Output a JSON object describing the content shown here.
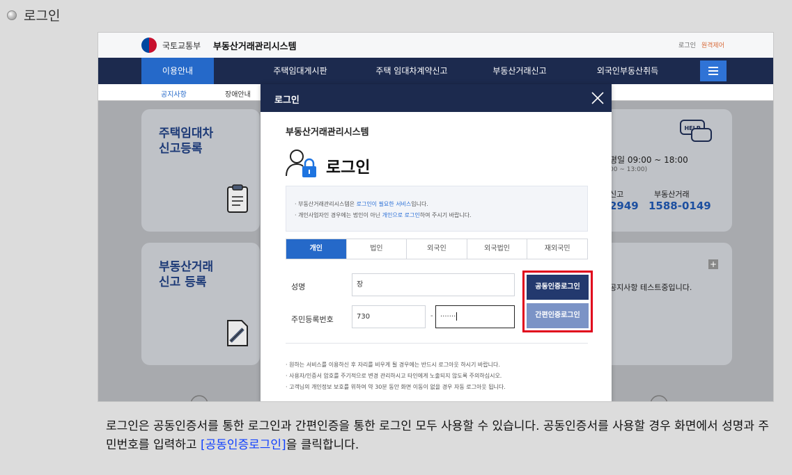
{
  "page": {
    "heading": "로그인",
    "caption_pre": "로그인은 공동인증서를 통한 로그인과 간편인증을 통한 로그인 모두 사용할 수 있습니다. 공동인증서를 사용할 경우 화면에서 성명과 주민번호를 입력하고 ",
    "caption_highlight": "[공동인증로그인]",
    "caption_post": "을 클릭합니다."
  },
  "site": {
    "org": "국토교통부",
    "system": "부동산거래관리시스템",
    "top_links": [
      "로그인",
      "원격제어"
    ]
  },
  "nav": {
    "items": [
      "이용안내",
      "주택임대게시판",
      "주택 임대차계약신고",
      "부동산거래신고",
      "외국인부동산취득"
    ],
    "sub_items": [
      "공지사항",
      "장애안내"
    ]
  },
  "background": {
    "card1_title": [
      "주택임대차",
      "신고등록"
    ],
    "card2_title": [
      "부동산거래",
      "신고 등록"
    ],
    "hours": "평일 09:00 ~ 18:00",
    "hours_sub": "00 ~ 13:00)",
    "phone1_label": "신고",
    "phone1": "2949",
    "phone2_label": "부동산거래",
    "phone2": "1588-0149",
    "notice": "공지사항 테스트중입니다.",
    "help_label": "HELP"
  },
  "modal": {
    "title": "로그인",
    "system_name": "부동산거래관리시스템",
    "heading": "로그인",
    "notice1_pre": "· 부동산거래관리시스템은 ",
    "notice1_hl": "로그인이 필요한 서비스",
    "notice1_post": "입니다.",
    "notice2_pre": "· 개인사업자인 경우에는 법인이 아닌 ",
    "notice2_hl": "개인으로 로그인",
    "notice2_post": "하여 주시기 바랍니다.",
    "tabs": [
      "개인",
      "법인",
      "외국인",
      "외국법인",
      "재외국민"
    ],
    "name_label": "성명",
    "name_value": "장",
    "rrn_label": "주민등록번호",
    "rrn_front": "730",
    "rrn_dash": "-",
    "rrn_back": "·······",
    "btn_cert": "공동인증로그인",
    "btn_simple": "간편인증로그인",
    "footer": [
      "· 원하는 서비스를 이용하신 후 자리를 비우게 될 경우에는 반드시 로그아웃 하시기 바랍니다.",
      "· 사용자/인증서 암호를 주기적으로 변경 관리하시고 타인에게 노출되지 않도록 주의하십시오.",
      "· 고객님의 개인정보 보호를 위하여 약 30분 동안 화면 이동이 없을 경우 자동 로그아웃 됩니다."
    ]
  },
  "colors": {
    "nav": "#1c2a4e",
    "accent": "#2569c9",
    "highlight_frame": "#e0001b",
    "caption_highlight": "#1040ff"
  },
  "icons": [
    "bullet-icon",
    "government-logo",
    "hamburger-icon",
    "close-icon",
    "user-lock-icon",
    "help-icon",
    "document-icon",
    "plus-icon"
  ]
}
